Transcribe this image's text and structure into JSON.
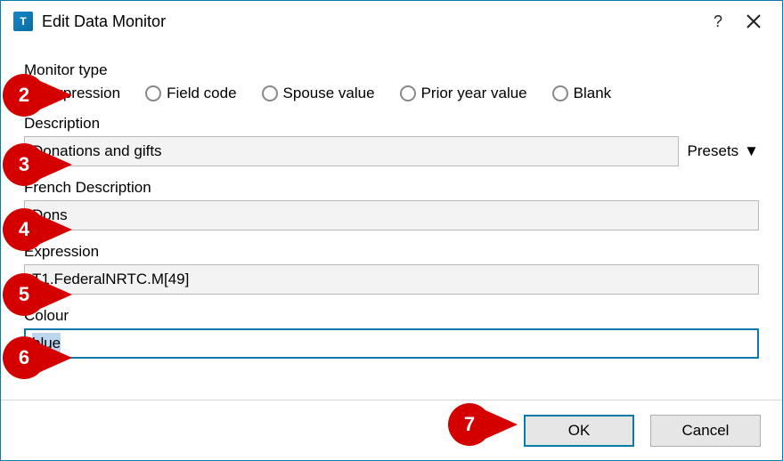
{
  "title": "Edit Data Monitor",
  "titlebar": {
    "help_tooltip": "?",
    "close_tooltip": "×"
  },
  "monitor_type": {
    "label": "Monitor type",
    "options": [
      {
        "label": "Expression",
        "selected": true,
        "name": "radio-expression"
      },
      {
        "label": "Field code",
        "selected": false,
        "name": "radio-field-code"
      },
      {
        "label": "Spouse value",
        "selected": false,
        "name": "radio-spouse-value"
      },
      {
        "label": "Prior year value",
        "selected": false,
        "name": "radio-prior-year-value"
      },
      {
        "label": "Blank",
        "selected": false,
        "name": "radio-blank"
      }
    ]
  },
  "description": {
    "label": "Description",
    "value": "Donations and gifts",
    "presets_label": "Presets"
  },
  "french_description": {
    "label": "French Description",
    "value": "Dons"
  },
  "expression": {
    "label": "Expression",
    "value": "T1.FederalNRTC.M[49]"
  },
  "colour": {
    "label": "Colour",
    "value": "blue"
  },
  "buttons": {
    "ok": "OK",
    "cancel": "Cancel"
  },
  "callouts": {
    "2": 2,
    "3": 3,
    "4": 4,
    "5": 5,
    "6": 6,
    "7": 7
  }
}
